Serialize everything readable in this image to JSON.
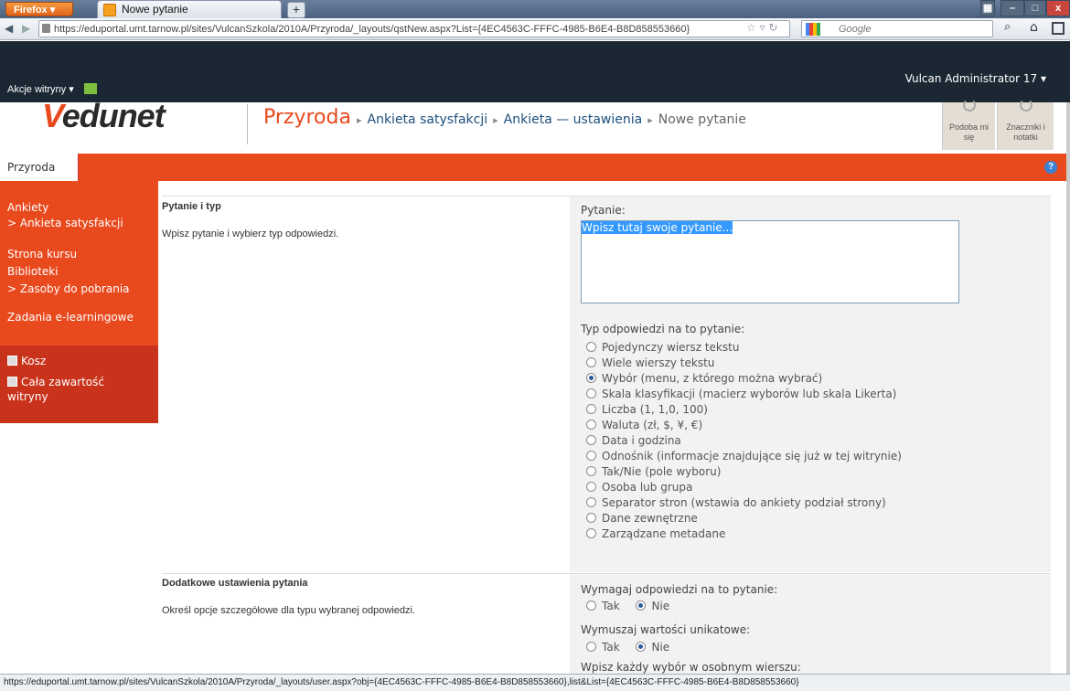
{
  "browser": {
    "menu_label": "Firefox ▾",
    "tab_title": "Nowe pytanie",
    "new_tab": "+",
    "url": "https://eduportal.umt.tarnow.pl/sites/VulcanSzkola/2010A/Przyroda/_layouts/qstNew.aspx?List={4EC4563C-FFFC-4985-B6E4-B8D858553660}",
    "search_engine": "Google",
    "status_url": "https://eduportal.umt.tarnow.pl/sites/VulcanSzkola/2010A/Przyroda/_layouts/user.aspx?obj={4EC4563C-FFFC-4985-B6E4-B8D858553660},list&List={4EC4563C-FFFC-4985-B6E4-B8D858553660}"
  },
  "ribbon": {
    "site_actions": "Akcje witryny ▾",
    "user": "Vulcan Administrator 17 ▾"
  },
  "header": {
    "logo_v": "V",
    "logo_text": "edunet",
    "site": "Przyroda",
    "crumbs": [
      "Ankieta satysfakcji",
      "Ankieta — ustawienia",
      "Nowe pytanie"
    ],
    "like_label": "Podoba mi się",
    "tags_label": "Znaczniki i notatki"
  },
  "topnav": {
    "tab": "Przyroda",
    "help": "?"
  },
  "leftnav": {
    "ankiety": "Ankiety",
    "ankieta_sub": "> Ankieta satysfakcji",
    "strona": "Strona kursu",
    "biblioteki": "Biblioteki",
    "zasoby": "> Zasoby do pobrania",
    "zadania": "Zadania e-learningowe",
    "kosz": "Kosz",
    "cala1": "Cała zawartość",
    "cala2": "witryny"
  },
  "section1": {
    "title": "Pytanie i typ",
    "desc": "Wpisz pytanie i wybierz typ odpowiedzi.",
    "question_label": "Pytanie:",
    "question_value": "Wpisz tutaj swoje pytanie...",
    "type_label": "Typ odpowiedzi na to pytanie:",
    "types": [
      "Pojedynczy wiersz tekstu",
      "Wiele wierszy tekstu",
      "Wybór (menu, z którego można wybrać)",
      "Skala klasyfikacji (macierz wyborów lub skala Likerta)",
      "Liczba (1, 1,0, 100)",
      "Waluta (zł, $, ¥, €)",
      "Data i godzina",
      "Odnośnik (informacje znajdujące się już w tej witrynie)",
      "Tak/Nie (pole wyboru)",
      "Osoba lub grupa",
      "Separator stron (wstawia do ankiety podział strony)",
      "Dane zewnętrzne",
      "Zarządzane metadane"
    ],
    "selected_type_index": 2
  },
  "section2": {
    "title": "Dodatkowe ustawienia pytania",
    "desc": "Określ opcje szczegółowe dla typu wybranej odpowiedzi.",
    "require_label": "Wymagaj odpowiedzi na to pytanie:",
    "unique_label": "Wymuszaj wartości unikatowe:",
    "yes": "Tak",
    "no": "Nie",
    "choices_label": "Wpisz każdy wybór w osobnym wierszu:"
  }
}
